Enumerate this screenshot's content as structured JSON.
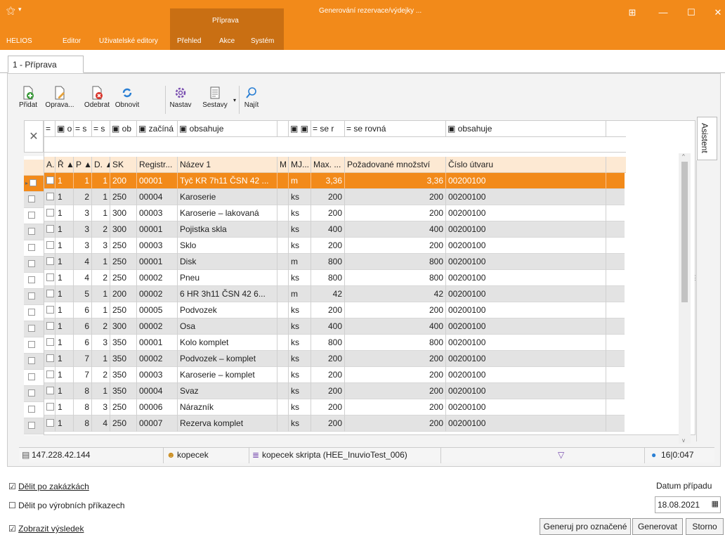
{
  "app": {
    "context_tab": "Příprava",
    "window_title": "Generování rezervace/výdejky ...",
    "ribbon": [
      "HELIOS",
      "Editor",
      "Uživatelské editory",
      "Přehled",
      "Akce",
      "Systém"
    ]
  },
  "doc_tab": "1 - Příprava",
  "toolbar": {
    "add": "Přidat",
    "edit": "Oprava...",
    "remove": "Odebrat",
    "refresh": "Obnovit",
    "settings": "Nastav",
    "reports": "Sestavy",
    "find": "Najít"
  },
  "filters": [
    "= ",
    "▣ o",
    "= s",
    "= s",
    "▣ ob",
    "▣ začíná",
    "▣ obsahuje",
    "",
    "▣ ▣ ol",
    "= se r",
    "= se rovná",
    "▣ obsahuje"
  ],
  "columns": [
    "A..",
    "Ř ▲",
    "P ▲",
    "D. ▲",
    "SK",
    "Registr...",
    "Název 1",
    "M",
    "MJ...",
    "Max. ...",
    "Požadované množství",
    "Číslo útvaru"
  ],
  "rows": [
    [
      "1",
      "1",
      "1",
      "200",
      "00001",
      "Tyč KR 7h11 ČSN 42 ...",
      "m",
      "3,36",
      "3,36",
      "00200100"
    ],
    [
      "1",
      "2",
      "1",
      "250",
      "00004",
      "Karoserie",
      "ks",
      "200",
      "200",
      "00200100"
    ],
    [
      "1",
      "3",
      "1",
      "300",
      "00003",
      "Karoserie – lakovaná",
      "ks",
      "200",
      "200",
      "00200100"
    ],
    [
      "1",
      "3",
      "2",
      "300",
      "00001",
      "Pojistka skla",
      "ks",
      "400",
      "400",
      "00200100"
    ],
    [
      "1",
      "3",
      "3",
      "250",
      "00003",
      "Sklo",
      "ks",
      "200",
      "200",
      "00200100"
    ],
    [
      "1",
      "4",
      "1",
      "250",
      "00001",
      "Disk",
      "m",
      "800",
      "800",
      "00200100"
    ],
    [
      "1",
      "4",
      "2",
      "250",
      "00002",
      "Pneu",
      "ks",
      "800",
      "800",
      "00200100"
    ],
    [
      "1",
      "5",
      "1",
      "200",
      "00002",
      "6 HR 3h11 ČSN 42 6...",
      "m",
      "42",
      "42",
      "00200100"
    ],
    [
      "1",
      "6",
      "1",
      "250",
      "00005",
      "Podvozek",
      "ks",
      "200",
      "200",
      "00200100"
    ],
    [
      "1",
      "6",
      "2",
      "300",
      "00002",
      "Osa",
      "ks",
      "400",
      "400",
      "00200100"
    ],
    [
      "1",
      "6",
      "3",
      "350",
      "00001",
      "Kolo komplet",
      "ks",
      "800",
      "800",
      "00200100"
    ],
    [
      "1",
      "7",
      "1",
      "350",
      "00002",
      "Podvozek – komplet",
      "ks",
      "200",
      "200",
      "00200100"
    ],
    [
      "1",
      "7",
      "2",
      "350",
      "00003",
      "Karoserie – komplet",
      "ks",
      "200",
      "200",
      "00200100"
    ],
    [
      "1",
      "8",
      "1",
      "350",
      "00004",
      "Svaz",
      "ks",
      "200",
      "200",
      "00200100"
    ],
    [
      "1",
      "8",
      "3",
      "250",
      "00006",
      "Nárazník",
      "ks",
      "200",
      "200",
      "00200100"
    ],
    [
      "1",
      "8",
      "4",
      "250",
      "00007",
      "Rezerva komplet",
      "ks",
      "200",
      "200",
      "00200100"
    ]
  ],
  "side_tab": "Asistent",
  "status": {
    "ip": "147.228.42.144",
    "user": "kopecek",
    "db": "kopecek skripta (HEE_InuvioTest_006)",
    "info": "16|0:047"
  },
  "options": {
    "split_orders": "Dělit po zakázkách",
    "split_production": "Dělit po výrobních příkazech",
    "show_result": "Zobrazit výsledek"
  },
  "date_label": "Datum případu",
  "date_value": "18.08.2021",
  "buttons": {
    "generate_marked": "Generuj pro označené",
    "generate": "Generovat",
    "cancel": "Storno"
  },
  "colors": {
    "accent": "#f28a1a",
    "accent_dark": "#c96f13",
    "row_alt": "#e3e3e3",
    "header_bg": "#fde9d3"
  }
}
